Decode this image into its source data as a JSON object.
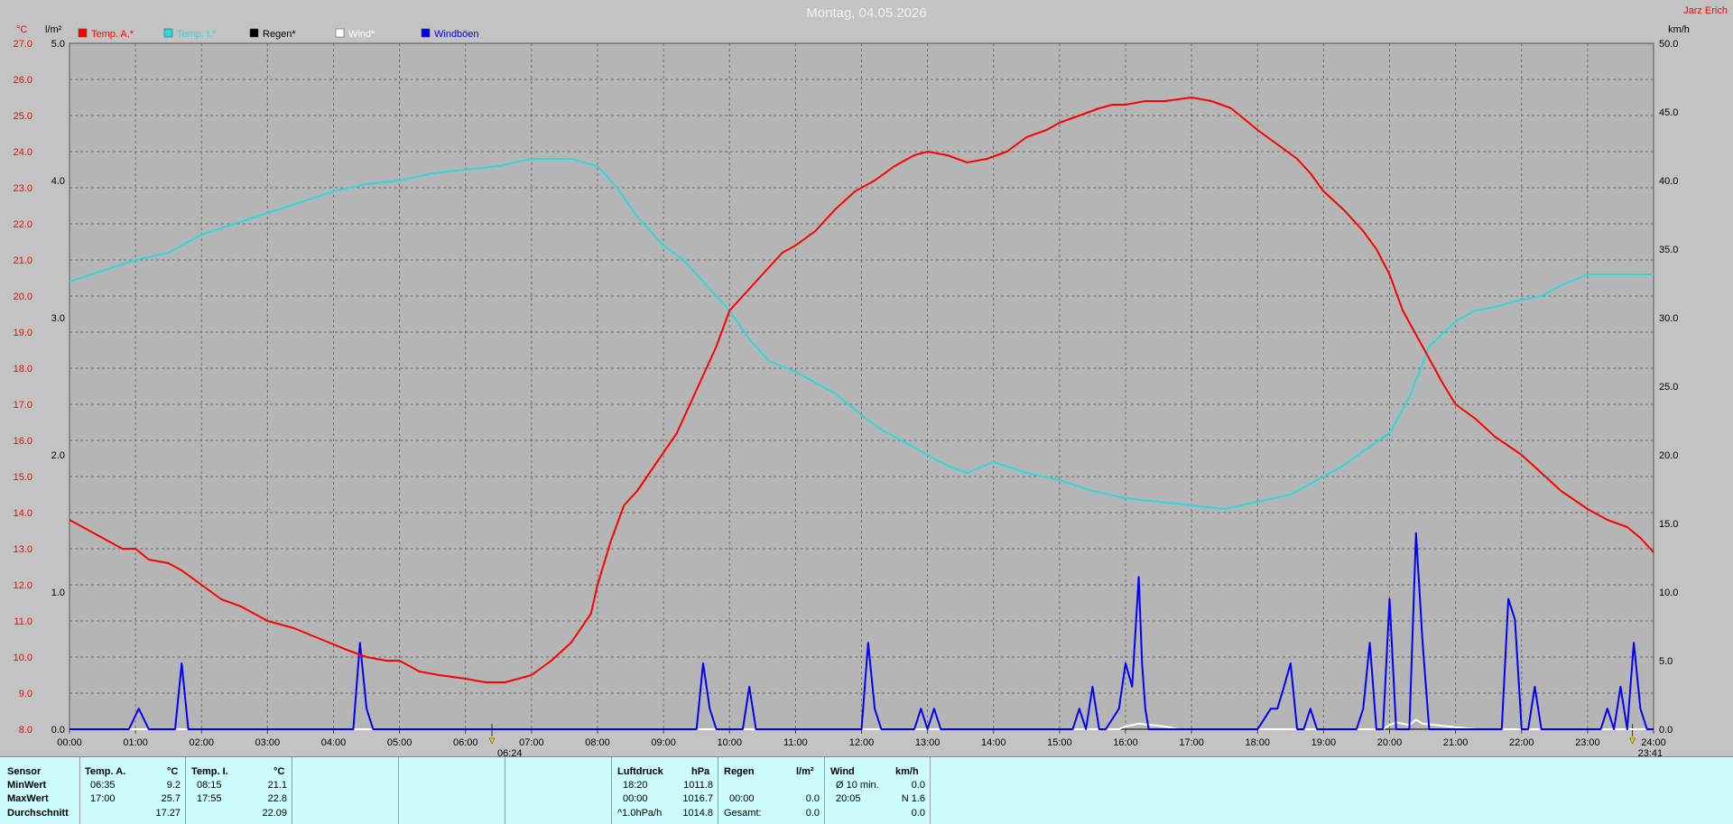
{
  "title": "Montag, 04.05.2026",
  "corner_label": "Jarz Erich",
  "colors": {
    "temp_a": "#ff0000",
    "temp_i": "#2fd8d8",
    "regen": "#000000",
    "wind": "#ffffff",
    "windboeen": "#0000ff",
    "bg": "#c3c3c3",
    "plot_bg": "#b5b5b5",
    "stats_bg": "#ccfcfc"
  },
  "chart_data": {
    "type": "line",
    "title": "Montag, 04.05.2026",
    "legend": [
      {
        "name": "Temp. A.*",
        "color": "#ff0000"
      },
      {
        "name": "Temp. I.*",
        "color": "#2fd8d8"
      },
      {
        "name": "Regen*",
        "color": "#000000"
      },
      {
        "name": "Wind*",
        "color": "#ffffff"
      },
      {
        "name": "Windböen",
        "color": "#0000ff"
      }
    ],
    "legend_position": "top-left",
    "grid": true,
    "x_ticks": [
      "00:00",
      "01:00",
      "02:00",
      "03:00",
      "04:00",
      "05:00",
      "06:00",
      "07:00",
      "08:00",
      "09:00",
      "10:00",
      "11:00",
      "12:00",
      "13:00",
      "14:00",
      "15:00",
      "16:00",
      "17:00",
      "18:00",
      "19:00",
      "20:00",
      "21:00",
      "22:00",
      "23:00",
      "24:00"
    ],
    "x_markers": [
      {
        "label": "06:24",
        "hour": 6.4
      },
      {
        "label": "23:41",
        "hour": 23.68
      }
    ],
    "axes": {
      "temp": {
        "unit": "°C",
        "range": [
          8.0,
          27.0
        ],
        "ticks": [
          "8.0",
          "9.0",
          "10.0",
          "11.0",
          "12.0",
          "13.0",
          "14.0",
          "15.0",
          "16.0",
          "17.0",
          "18.0",
          "19.0",
          "20.0",
          "21.0",
          "22.0",
          "23.0",
          "24.0",
          "25.0",
          "26.0",
          "27.0"
        ]
      },
      "rain": {
        "unit": "l/m²",
        "range": [
          0,
          5
        ],
        "ticks": [
          "0.0",
          "1.0",
          "2.0",
          "3.0",
          "4.0",
          "5.0"
        ]
      },
      "wind": {
        "unit": "km/h",
        "range": [
          0,
          50
        ],
        "ticks": [
          "0.0",
          "5.0",
          "10.0",
          "15.0",
          "20.0",
          "25.0",
          "30.0",
          "35.0",
          "40.0",
          "45.0",
          "50.0"
        ]
      }
    },
    "series": [
      {
        "name": "Temp. A.*",
        "axis": "temp",
        "x": [
          0,
          0.3,
          0.6,
          0.8,
          1.0,
          1.2,
          1.5,
          1.7,
          2.0,
          2.3,
          2.6,
          3.0,
          3.4,
          3.8,
          4.2,
          4.5,
          4.8,
          5.0,
          5.3,
          5.6,
          6.0,
          6.3,
          6.6,
          7.0,
          7.3,
          7.6,
          7.9,
          8.0,
          8.2,
          8.4,
          8.6,
          8.9,
          9.2,
          9.5,
          9.8,
          10.0,
          10.3,
          10.6,
          10.8,
          11.0,
          11.3,
          11.6,
          11.9,
          12.2,
          12.5,
          12.8,
          13.0,
          13.3,
          13.6,
          13.9,
          14.2,
          14.5,
          14.8,
          15.0,
          15.3,
          15.6,
          15.8,
          16.0,
          16.3,
          16.6,
          17.0,
          17.3,
          17.6,
          17.8,
          18.0,
          18.3,
          18.6,
          18.8,
          19.0,
          19.3,
          19.6,
          19.8,
          20.0,
          20.2,
          20.5,
          20.8,
          21.0,
          21.3,
          21.6,
          22.0,
          22.3,
          22.6,
          23.0,
          23.3,
          23.6,
          23.8,
          24.0
        ],
        "values": [
          13.8,
          13.5,
          13.2,
          13.0,
          13.0,
          12.7,
          12.6,
          12.4,
          12.0,
          11.6,
          11.4,
          11.0,
          10.8,
          10.5,
          10.2,
          10.0,
          9.9,
          9.9,
          9.6,
          9.5,
          9.4,
          9.3,
          9.3,
          9.5,
          9.9,
          10.4,
          11.2,
          12.0,
          13.2,
          14.2,
          14.6,
          15.4,
          16.2,
          17.4,
          18.6,
          19.6,
          20.2,
          20.8,
          21.2,
          21.4,
          21.8,
          22.4,
          22.9,
          23.2,
          23.6,
          23.9,
          24.0,
          23.9,
          23.7,
          23.8,
          24.0,
          24.4,
          24.6,
          24.8,
          25.0,
          25.2,
          25.3,
          25.3,
          25.4,
          25.4,
          25.5,
          25.4,
          25.2,
          24.9,
          24.6,
          24.2,
          23.8,
          23.4,
          22.9,
          22.4,
          21.8,
          21.3,
          20.6,
          19.6,
          18.6,
          17.6,
          17.0,
          16.6,
          16.1,
          15.6,
          15.1,
          14.6,
          14.1,
          13.8,
          13.6,
          13.3,
          12.9
        ]
      },
      {
        "name": "Temp. I.*",
        "axis": "temp",
        "x": [
          0,
          0.5,
          1.0,
          1.5,
          2.0,
          2.5,
          3.0,
          3.5,
          4.0,
          4.5,
          5.0,
          5.5,
          6.0,
          6.5,
          7.0,
          7.3,
          7.6,
          8.0,
          8.3,
          8.6,
          9.0,
          9.3,
          9.6,
          10.0,
          10.3,
          10.6,
          11.0,
          11.3,
          11.6,
          12.0,
          12.3,
          12.6,
          13.0,
          13.3,
          13.6,
          14.0,
          14.5,
          15.0,
          15.5,
          16.0,
          16.5,
          17.0,
          17.5,
          18.0,
          18.5,
          18.8,
          19.0,
          19.3,
          19.6,
          20.0,
          20.3,
          20.6,
          21.0,
          21.3,
          21.6,
          22.0,
          22.3,
          22.6,
          23.0,
          23.3,
          23.6,
          24.0
        ],
        "values": [
          20.4,
          20.7,
          21.0,
          21.2,
          21.7,
          22.0,
          22.3,
          22.6,
          22.9,
          23.1,
          23.2,
          23.4,
          23.5,
          23.6,
          23.8,
          23.8,
          23.8,
          23.6,
          23.0,
          22.2,
          21.4,
          21.0,
          20.4,
          19.6,
          18.8,
          18.2,
          17.9,
          17.6,
          17.3,
          16.7,
          16.3,
          16.0,
          15.6,
          15.3,
          15.1,
          15.4,
          15.1,
          14.9,
          14.6,
          14.4,
          14.3,
          14.2,
          14.1,
          14.3,
          14.5,
          14.8,
          15.0,
          15.3,
          15.7,
          16.2,
          17.2,
          18.6,
          19.3,
          19.6,
          19.7,
          19.9,
          20.0,
          20.3,
          20.6,
          20.6,
          20.6,
          20.6
        ]
      },
      {
        "name": "Windböen",
        "axis": "wind",
        "x": [
          0,
          0.9,
          1.05,
          1.2,
          1.6,
          1.7,
          1.8,
          4.3,
          4.4,
          4.5,
          4.6,
          9.5,
          9.6,
          9.7,
          9.8,
          10.2,
          10.3,
          10.4,
          12.0,
          12.1,
          12.2,
          12.3,
          12.8,
          12.9,
          13.0,
          13.1,
          13.2,
          15.2,
          15.3,
          15.4,
          15.5,
          15.6,
          15.7,
          15.9,
          16.0,
          16.1,
          16.2,
          16.25,
          16.3,
          16.35,
          16.4,
          16.5,
          16.6,
          18.0,
          18.2,
          18.3,
          18.4,
          18.5,
          18.6,
          18.7,
          18.8,
          18.9,
          19.5,
          19.6,
          19.7,
          19.8,
          19.9,
          20.0,
          20.1,
          20.3,
          20.4,
          20.5,
          20.6,
          21.7,
          21.8,
          21.9,
          22.0,
          22.1,
          22.2,
          22.3,
          22.4,
          22.5,
          23.2,
          23.3,
          23.4,
          23.5,
          23.6,
          23.7,
          23.8,
          23.9,
          24.0
        ],
        "values": [
          0,
          0,
          1.5,
          0,
          0,
          4.8,
          0,
          0,
          6.3,
          1.5,
          0,
          0,
          4.8,
          1.5,
          0,
          0,
          3.1,
          0,
          0,
          6.3,
          1.5,
          0,
          0,
          1.5,
          0,
          1.5,
          0,
          0,
          1.5,
          0,
          3.1,
          0,
          0,
          1.5,
          4.8,
          3.1,
          11.1,
          4.8,
          1.5,
          0,
          0,
          0,
          0,
          0,
          1.5,
          1.5,
          3.1,
          4.8,
          0,
          0,
          1.5,
          0,
          0,
          1.5,
          6.3,
          0,
          0,
          9.5,
          0,
          0,
          14.3,
          6.3,
          0,
          0,
          9.5,
          8.0,
          0,
          0,
          3.1,
          0,
          0,
          0,
          0,
          1.5,
          0,
          3.1,
          0,
          6.3,
          1.5,
          0,
          0
        ]
      },
      {
        "name": "Wind*",
        "axis": "wind",
        "x": [
          0,
          15.9,
          16.0,
          16.2,
          16.4,
          16.6,
          16.8,
          19.9,
          20.0,
          20.1,
          20.3,
          20.4,
          20.5,
          20.7,
          20.9,
          21.1,
          21.3,
          24.0
        ],
        "values": [
          0,
          0,
          0.2,
          0.4,
          0.3,
          0.2,
          0,
          0,
          0.3,
          0.5,
          0.3,
          0.7,
          0.4,
          0.3,
          0.2,
          0.1,
          0,
          0
        ]
      },
      {
        "name": "Regen*",
        "axis": "rain",
        "x": [
          0,
          24
        ],
        "values": [
          0,
          0
        ]
      }
    ]
  },
  "stats": {
    "sensor_label": "Sensor",
    "min_label": "MinWert",
    "max_label": "MaxWert",
    "avg_label": "Durchschnitt",
    "temp_a": {
      "label": "Temp. A.",
      "unit": "°C",
      "min_time": "06:35",
      "min_val": "9.2",
      "max_time": "17:00",
      "max_val": "25.7",
      "avg": "17.27"
    },
    "temp_i": {
      "label": "Temp. I.",
      "unit": "°C",
      "min_time": "08:15",
      "min_val": "21.1",
      "max_time": "17:55",
      "max_val": "22.8",
      "avg": "22.09"
    },
    "pressure": {
      "label": "Luftdruck",
      "unit": "hPa",
      "r1_time": "18:20",
      "r1_val": "1011.8",
      "r2_time": "00:00",
      "r2_val": "1016.7",
      "r3_label": "^1.0hPa/h",
      "r3_val": "1014.8"
    },
    "rain": {
      "label": "Regen",
      "unit": "l/m²",
      "r2_time": "00:00",
      "r2_val": "0.0",
      "r3_label": "Gesamt:",
      "r3_val": "0.0"
    },
    "wind": {
      "label": "Wind",
      "unit": "km/h",
      "r1_label": "Ø 10 min.",
      "r1_val": "0.0",
      "r2_time": "20:05",
      "r2_val": "N 1.6",
      "r3_val": "0.0"
    }
  }
}
